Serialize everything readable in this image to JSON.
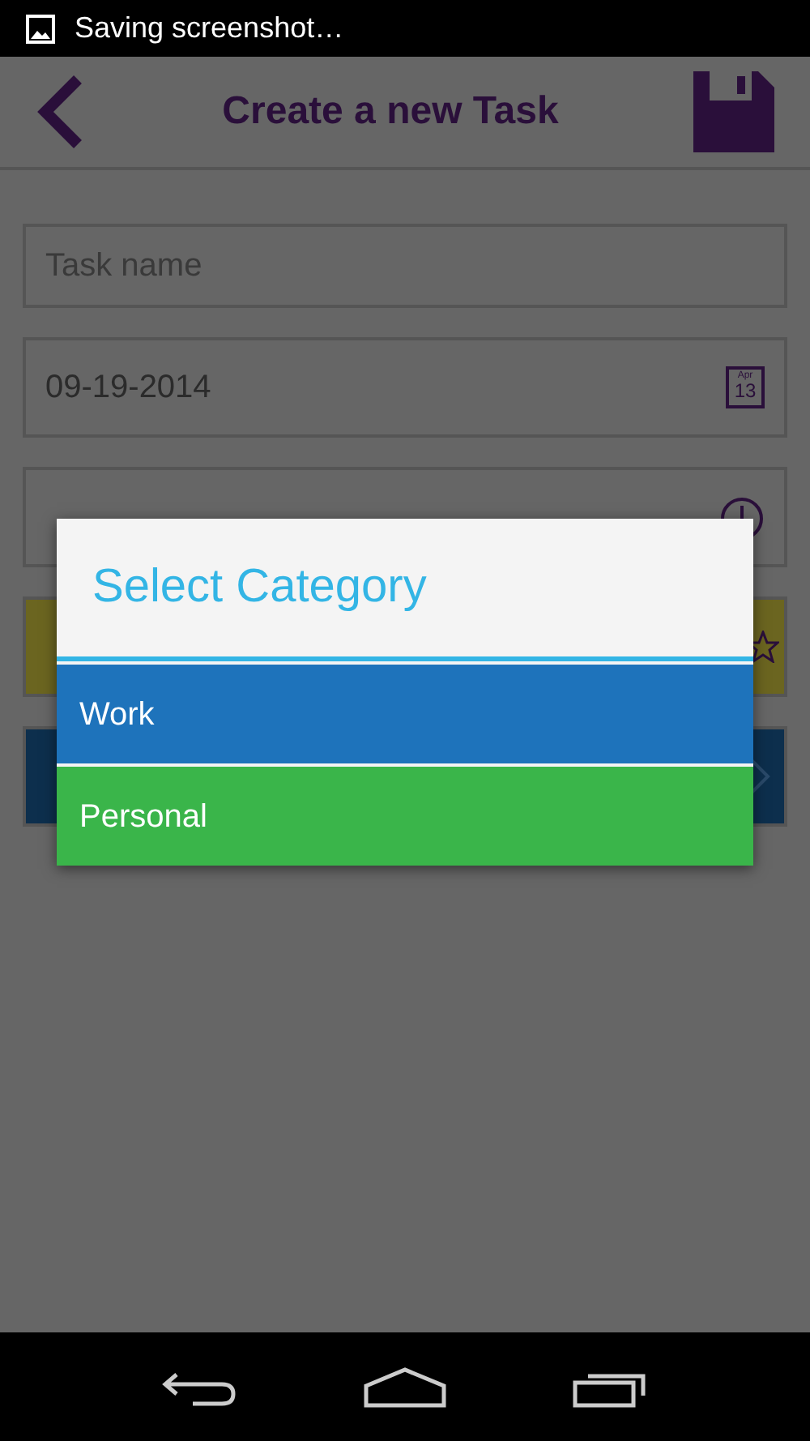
{
  "status_bar": {
    "notification": "Saving screenshot…"
  },
  "header": {
    "title": "Create a new Task"
  },
  "form": {
    "task_name": {
      "placeholder": "Task name"
    },
    "date": {
      "value": "09-19-2014",
      "calendar_month": "Apr",
      "calendar_day": "13"
    }
  },
  "dialog": {
    "title": "Select Category",
    "options": [
      {
        "label": "Work",
        "color": "#1e73bb"
      },
      {
        "label": "Personal",
        "color": "#3ab54a"
      }
    ]
  }
}
